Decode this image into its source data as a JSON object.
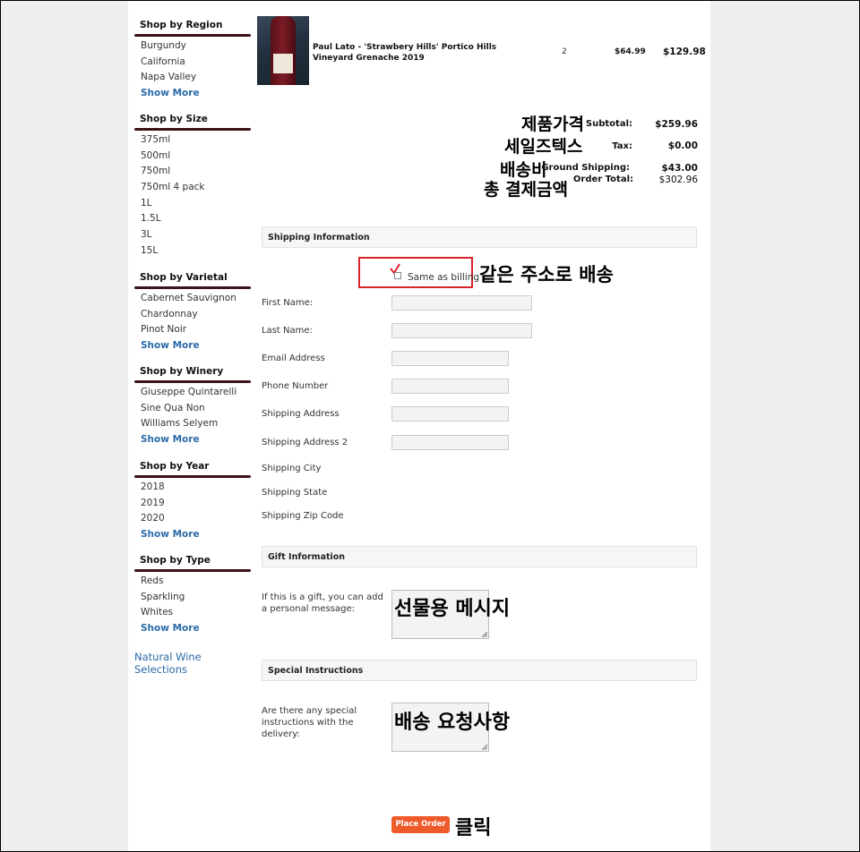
{
  "sidebar": {
    "sections": [
      {
        "title": "Shop by Region",
        "items": [
          "Burgundy",
          "California",
          "Napa Valley"
        ],
        "more": "Show More"
      },
      {
        "title": "Shop by Size",
        "items": [
          "375ml",
          "500ml",
          "750ml",
          "750ml 4 pack",
          "1L",
          "1.5L",
          "3L",
          "15L"
        ],
        "more": ""
      },
      {
        "title": "Shop by Varietal",
        "items": [
          "Cabernet Sauvignon",
          "Chardonnay",
          "Pinot Noir"
        ],
        "more": "Show More"
      },
      {
        "title": "Shop by Winery",
        "items": [
          "Giuseppe Quintarelli",
          "Sine Qua Non",
          "Williams Selyem"
        ],
        "more": "Show More"
      },
      {
        "title": "Shop by Year",
        "items": [
          "2018",
          "2019",
          "2020"
        ],
        "more": "Show More"
      },
      {
        "title": "Shop by Type",
        "items": [
          "Reds",
          "Sparkling",
          "Whites"
        ],
        "more": "Show More"
      }
    ],
    "natural_link": "Natural Wine Selections"
  },
  "product": {
    "name": "Paul Lato - 'Strawbery Hills' Portico Hills Vineyard Grenache 2019",
    "qty": "2",
    "price": "$64.99",
    "total": "$129.98"
  },
  "totals": {
    "subtotal_label": "Subtotal:",
    "subtotal": "$259.96",
    "tax_label": "Tax:",
    "tax": "$0.00",
    "shipping_label": "Ground Shipping:",
    "shipping": "$43.00",
    "order_label": "Order Total:",
    "order_total": "$302.96"
  },
  "annotations": {
    "subtotal": "제품가격",
    "tax": "세일즈텍스",
    "shipping": "배송비",
    "order_total": "총 결제금액",
    "same_billing": "같은 주소로 배송",
    "gift": "선물용 메시지",
    "special": "배송 요청사항",
    "click": "클릭"
  },
  "shipping": {
    "header": "Shipping Information",
    "same_as_billing": "Same as billing",
    "fields": {
      "first_name": "First Name:",
      "last_name": "Last Name:",
      "email": "Email Address",
      "phone": "Phone Number",
      "address": "Shipping Address",
      "address2": "Shipping Address 2",
      "city": "Shipping City",
      "state": "Shipping State",
      "zip": "Shipping Zip Code"
    }
  },
  "gift": {
    "header": "Gift Information",
    "prompt": "If this is a gift, you can add a personal message:"
  },
  "special": {
    "header": "Special Instructions",
    "prompt": "Are there any special instructions with the delivery:"
  },
  "place_order": "Place Order",
  "colors": {
    "accent": "#ee5a2a",
    "link": "#2a6aa8",
    "rule": "#3a1218",
    "highlight": "#d6232a"
  }
}
